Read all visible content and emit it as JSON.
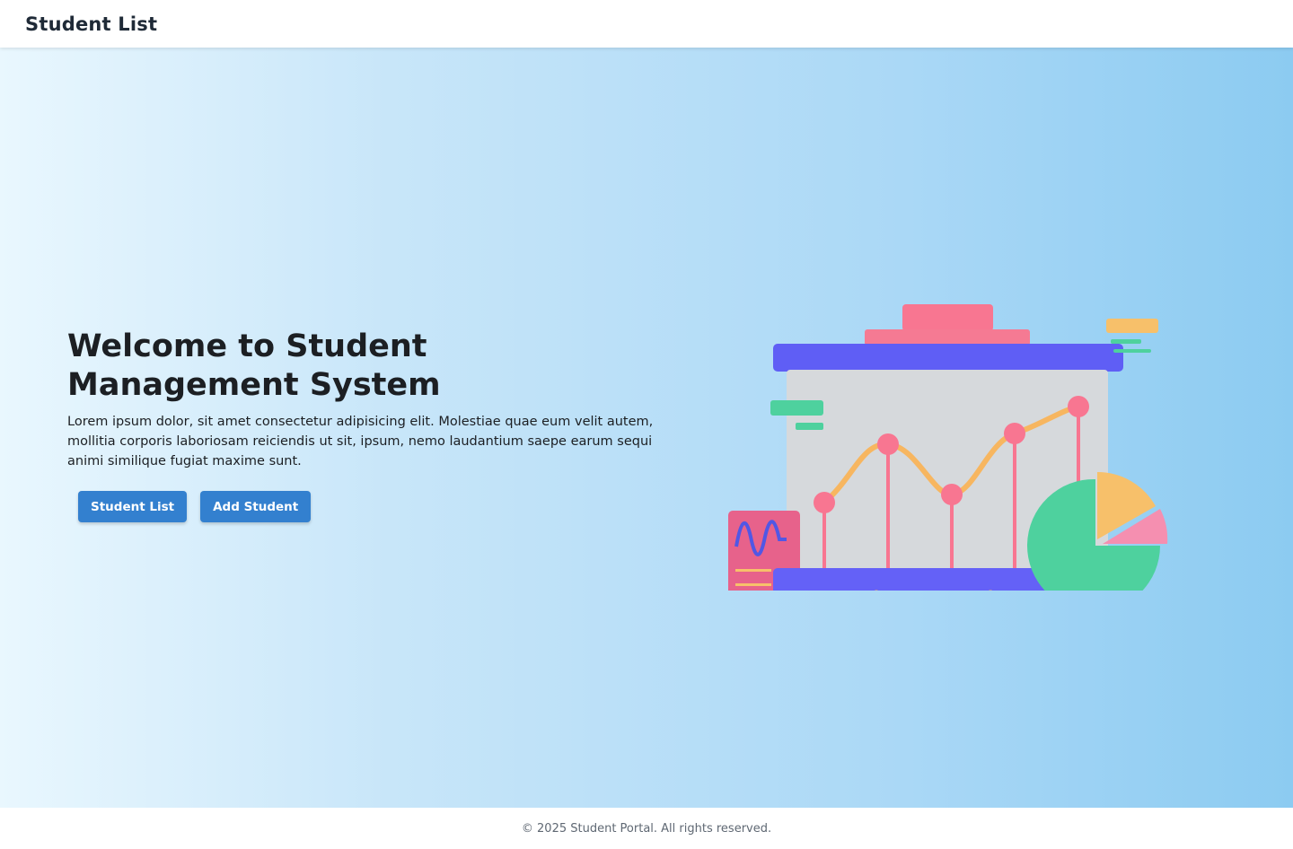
{
  "navbar": {
    "brand": "Student List"
  },
  "hero": {
    "title": "Welcome to Student Management System",
    "description": "Lorem ipsum dolor, sit amet consectetur adipisicing elit. Molestiae quae eum velit autem, mollitia corporis laboriosam reiciendis ut sit, ipsum, nemo laudantium saepe earum sequi animi similique fugiat maxime sunt.",
    "buttons": {
      "student_list": "Student List",
      "add_student": "Add Student"
    }
  },
  "illustration": {
    "name": "presentation-board-chart-illustration"
  },
  "footer": {
    "copyright": "© 2025 Student Portal. All rights reserved."
  },
  "colors": {
    "accent": "#3380cf",
    "board_bar": "#5f5ef5",
    "pink": "#f87691",
    "green": "#4ed19e",
    "orange": "#f7c06a"
  }
}
